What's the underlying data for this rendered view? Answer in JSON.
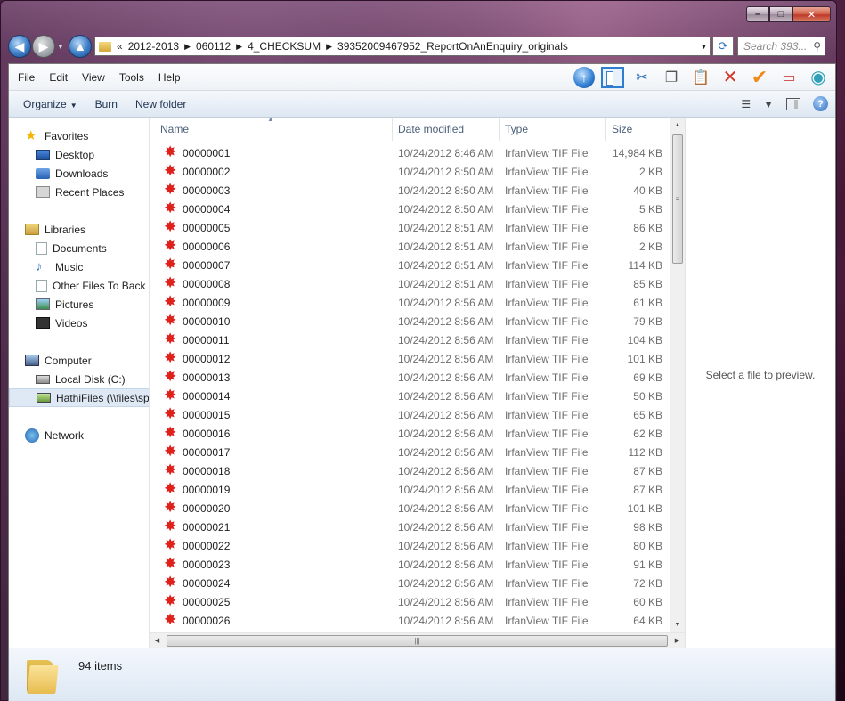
{
  "address": {
    "overflow": "«",
    "breadcrumbs": [
      "2012-2013",
      "060112",
      "4_CHECKSUM",
      "39352009467952_ReportOnAnEnquiry_originals"
    ],
    "search_placeholder": "Search 393..."
  },
  "caption": {
    "minimize": "–",
    "maximize": "□",
    "close": "✕"
  },
  "menu": [
    "File",
    "Edit",
    "View",
    "Tools",
    "Help"
  ],
  "commands": {
    "organize": "Organize",
    "burn": "Burn",
    "new_folder": "New folder"
  },
  "nav": {
    "favorites": {
      "label": "Favorites",
      "items": [
        "Desktop",
        "Downloads",
        "Recent Places"
      ]
    },
    "libraries": {
      "label": "Libraries",
      "items": [
        "Documents",
        "Music",
        "Other Files To Back Up",
        "Pictures",
        "Videos"
      ]
    },
    "computer": {
      "label": "Computer",
      "items": [
        "Local Disk (C:)",
        "HathiFiles (\\\\files\\sp"
      ]
    },
    "network": {
      "label": "Network"
    }
  },
  "columns": {
    "name": "Name",
    "date": "Date modified",
    "type": "Type",
    "size": "Size"
  },
  "files": [
    {
      "name": "00000001",
      "date": "10/24/2012 8:46 AM",
      "type": "IrfanView TIF File",
      "size": "14,984 KB"
    },
    {
      "name": "00000002",
      "date": "10/24/2012 8:50 AM",
      "type": "IrfanView TIF File",
      "size": "2 KB"
    },
    {
      "name": "00000003",
      "date": "10/24/2012 8:50 AM",
      "type": "IrfanView TIF File",
      "size": "40 KB"
    },
    {
      "name": "00000004",
      "date": "10/24/2012 8:50 AM",
      "type": "IrfanView TIF File",
      "size": "5 KB"
    },
    {
      "name": "00000005",
      "date": "10/24/2012 8:51 AM",
      "type": "IrfanView TIF File",
      "size": "86 KB"
    },
    {
      "name": "00000006",
      "date": "10/24/2012 8:51 AM",
      "type": "IrfanView TIF File",
      "size": "2 KB"
    },
    {
      "name": "00000007",
      "date": "10/24/2012 8:51 AM",
      "type": "IrfanView TIF File",
      "size": "114 KB"
    },
    {
      "name": "00000008",
      "date": "10/24/2012 8:51 AM",
      "type": "IrfanView TIF File",
      "size": "85 KB"
    },
    {
      "name": "00000009",
      "date": "10/24/2012 8:56 AM",
      "type": "IrfanView TIF File",
      "size": "61 KB"
    },
    {
      "name": "00000010",
      "date": "10/24/2012 8:56 AM",
      "type": "IrfanView TIF File",
      "size": "79 KB"
    },
    {
      "name": "00000011",
      "date": "10/24/2012 8:56 AM",
      "type": "IrfanView TIF File",
      "size": "104 KB"
    },
    {
      "name": "00000012",
      "date": "10/24/2012 8:56 AM",
      "type": "IrfanView TIF File",
      "size": "101 KB"
    },
    {
      "name": "00000013",
      "date": "10/24/2012 8:56 AM",
      "type": "IrfanView TIF File",
      "size": "69 KB"
    },
    {
      "name": "00000014",
      "date": "10/24/2012 8:56 AM",
      "type": "IrfanView TIF File",
      "size": "50 KB"
    },
    {
      "name": "00000015",
      "date": "10/24/2012 8:56 AM",
      "type": "IrfanView TIF File",
      "size": "65 KB"
    },
    {
      "name": "00000016",
      "date": "10/24/2012 8:56 AM",
      "type": "IrfanView TIF File",
      "size": "62 KB"
    },
    {
      "name": "00000017",
      "date": "10/24/2012 8:56 AM",
      "type": "IrfanView TIF File",
      "size": "112 KB"
    },
    {
      "name": "00000018",
      "date": "10/24/2012 8:56 AM",
      "type": "IrfanView TIF File",
      "size": "87 KB"
    },
    {
      "name": "00000019",
      "date": "10/24/2012 8:56 AM",
      "type": "IrfanView TIF File",
      "size": "87 KB"
    },
    {
      "name": "00000020",
      "date": "10/24/2012 8:56 AM",
      "type": "IrfanView TIF File",
      "size": "101 KB"
    },
    {
      "name": "00000021",
      "date": "10/24/2012 8:56 AM",
      "type": "IrfanView TIF File",
      "size": "98 KB"
    },
    {
      "name": "00000022",
      "date": "10/24/2012 8:56 AM",
      "type": "IrfanView TIF File",
      "size": "80 KB"
    },
    {
      "name": "00000023",
      "date": "10/24/2012 8:56 AM",
      "type": "IrfanView TIF File",
      "size": "91 KB"
    },
    {
      "name": "00000024",
      "date": "10/24/2012 8:56 AM",
      "type": "IrfanView TIF File",
      "size": "72 KB"
    },
    {
      "name": "00000025",
      "date": "10/24/2012 8:56 AM",
      "type": "IrfanView TIF File",
      "size": "60 KB"
    },
    {
      "name": "00000026",
      "date": "10/24/2012 8:56 AM",
      "type": "IrfanView TIF File",
      "size": "64 KB"
    }
  ],
  "preview": {
    "message": "Select a file to preview."
  },
  "details": {
    "item_count": "94 items"
  }
}
